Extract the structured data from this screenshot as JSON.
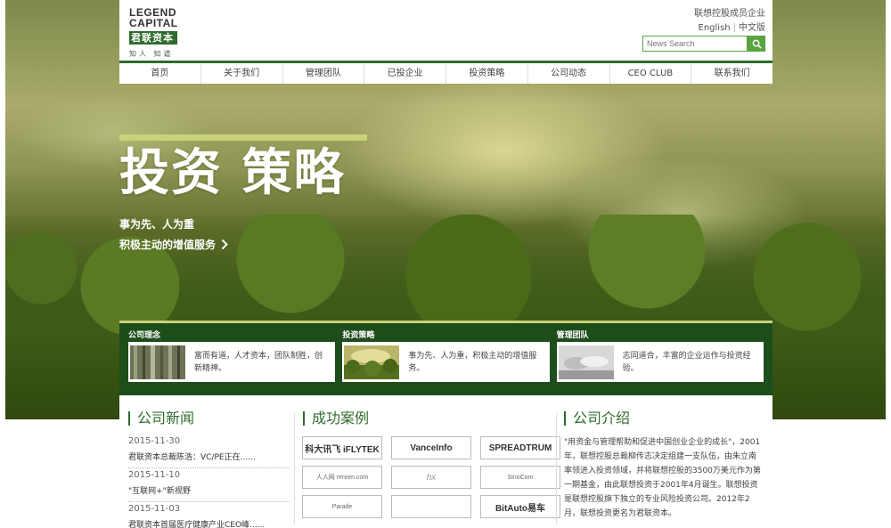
{
  "header": {
    "logo": {
      "line1": "LEGEND",
      "line2": "CAPITAL",
      "cn_name": "君联资本",
      "slogan": "知人 知道"
    },
    "member_text": "联想控股成员企业",
    "lang_en": "English",
    "lang_cn": "中文版",
    "search_placeholder": "News Search"
  },
  "nav": {
    "items": [
      "首页",
      "关于我们",
      "管理团队",
      "已投企业",
      "投资策略",
      "公司动态",
      "CEO CLUB",
      "联系我们"
    ]
  },
  "hero": {
    "title": "投资 策略",
    "subtitle1": "事为先、人为重",
    "subtitle2": "积极主动的增值服务"
  },
  "strip": {
    "cards": [
      {
        "title": "公司理念",
        "text": "富而有道，人才资本，团队制胜，创新精神。"
      },
      {
        "title": "投资策略",
        "text": "事为先、人为重，积极主动的增值服务。"
      },
      {
        "title": "管理团队",
        "text": "志同道合，丰富的企业运作与投资经验。"
      }
    ]
  },
  "news": {
    "title": "公司新闻",
    "items": [
      {
        "date": "2015-11-30",
        "text": "君联资本总裁陈浩：VC/PE正在......"
      },
      {
        "date": "2015-11-10",
        "text": "\"互联网+\"新视野"
      },
      {
        "date": "2015-11-03",
        "text": "君联资本首届医疗健康产业CEO峰......"
      }
    ]
  },
  "cases": {
    "title": "成功案例",
    "logos": [
      "科大讯飞 iFLYTEK",
      "VanceInfo",
      "SPREADTRUM",
      "人人网 renren.com",
      "hx",
      "SinoCom",
      "Parade",
      "",
      "BitAuto易车"
    ]
  },
  "intro": {
    "title": "公司介绍",
    "text": "\"用资金与管理帮助和促进中国创业企业的成长\"，2001年，联想控股总裁柳传志决定组建一支队伍，由朱立南率领进入投资领域，并将联想控股的3500万美元作为第一期基金，由此联想投资于2001年4月诞生。联想投资是联想控股旗下独立的专业风险投资公司。2012年2月，联想投资更名为君联资本。"
  },
  "colors": {
    "brand_green": "#2f6b2c",
    "accent_green": "#5aa33f",
    "accent_yellow": "#c9d27a"
  }
}
